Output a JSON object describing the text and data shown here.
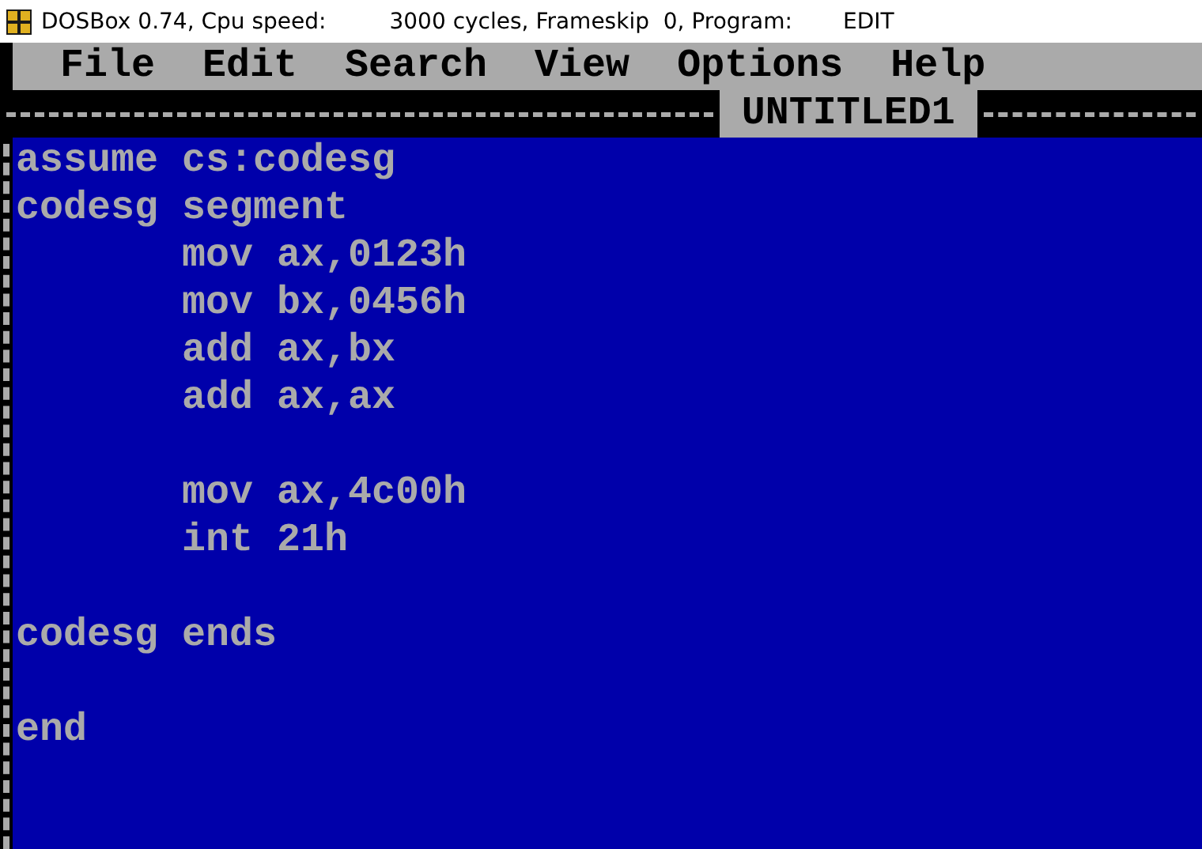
{
  "window": {
    "title_parts": [
      "DOSBox 0.74, Cpu speed:",
      "3000 cycles, Frameskip  0, Program:",
      "EDIT"
    ]
  },
  "menu": [
    "File",
    "Edit",
    "Search",
    "View",
    "Options",
    "Help"
  ],
  "document": {
    "title": "UNTITLED1"
  },
  "lines": [
    {
      "kind": "directive",
      "text": "assume cs:codesg"
    },
    {
      "kind": "directive",
      "text": "codesg segment"
    },
    {
      "kind": "instruction",
      "text": "mov ax,0123h"
    },
    {
      "kind": "instruction",
      "text": "mov bx,0456h"
    },
    {
      "kind": "instruction",
      "text": "add ax,bx"
    },
    {
      "kind": "instruction",
      "text": "add ax,ax"
    },
    {
      "kind": "blank"
    },
    {
      "kind": "instruction",
      "text": "mov ax,4c00h"
    },
    {
      "kind": "instruction",
      "text": "int 21h"
    },
    {
      "kind": "blank"
    },
    {
      "kind": "directive",
      "text": "codesg ends"
    },
    {
      "kind": "blank"
    },
    {
      "kind": "directive",
      "text": "end"
    },
    {
      "kind": "blank"
    },
    {
      "kind": "blank"
    }
  ]
}
